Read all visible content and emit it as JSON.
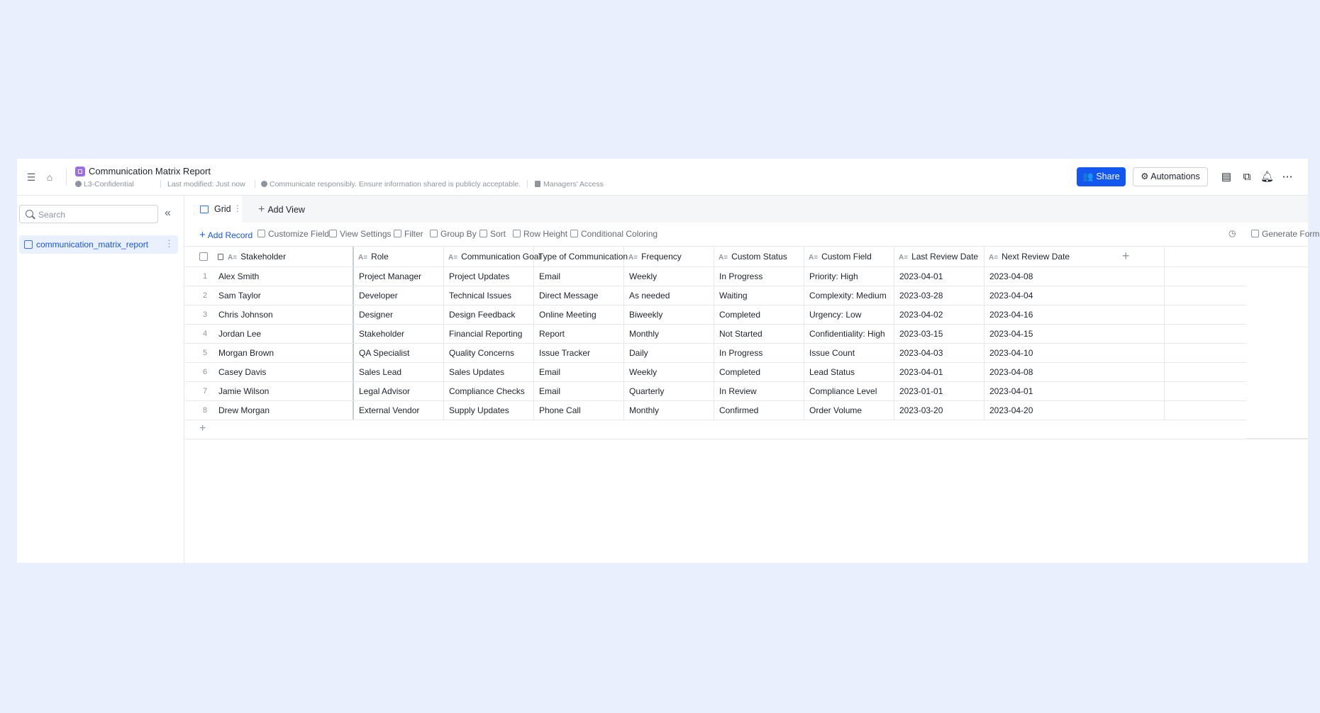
{
  "header": {
    "title": "Communication Matrix Report",
    "classification": "L3-Confidential",
    "last_modified": "Last modified: Just now",
    "notice": "Communicate responsibly. Ensure information shared is publicly acceptable.",
    "access": "Managers' Access",
    "share_label": "Share",
    "automations_label": "Automations"
  },
  "sidebar": {
    "search_placeholder": "Search",
    "items": [
      {
        "label": "communication_matrix_report"
      }
    ]
  },
  "views": {
    "active_tab": "Grid",
    "add_view_label": "Add View"
  },
  "toolbar": {
    "add_record": "Add Record",
    "customize_field": "Customize Field",
    "view_settings": "View Settings",
    "filter": "Filter",
    "group_by": "Group By",
    "sort": "Sort",
    "row_height": "Row Height",
    "conditional_coloring": "Conditional Coloring",
    "generate_form": "Generate Form"
  },
  "table": {
    "columns": [
      "Stakeholder",
      "Role",
      "Communication Goal",
      "Type of Communication",
      "Frequency",
      "Custom Status",
      "Custom Field",
      "Last Review Date",
      "Next Review Date"
    ],
    "rows": [
      [
        "Alex Smith",
        "Project Manager",
        "Project Updates",
        "Email",
        "Weekly",
        "In Progress",
        "Priority: High",
        "2023-04-01",
        "2023-04-08"
      ],
      [
        "Sam Taylor",
        "Developer",
        "Technical Issues",
        "Direct Message",
        "As needed",
        "Waiting",
        "Complexity: Medium",
        "2023-03-28",
        "2023-04-04"
      ],
      [
        "Chris Johnson",
        "Designer",
        "Design Feedback",
        "Online Meeting",
        "Biweekly",
        "Completed",
        "Urgency: Low",
        "2023-04-02",
        "2023-04-16"
      ],
      [
        "Jordan Lee",
        "Stakeholder",
        "Financial Reporting",
        "Report",
        "Monthly",
        "Not Started",
        "Confidentiality: High",
        "2023-03-15",
        "2023-04-15"
      ],
      [
        "Morgan Brown",
        "QA Specialist",
        "Quality Concerns",
        "Issue Tracker",
        "Daily",
        "In Progress",
        "Issue Count",
        "2023-04-03",
        "2023-04-10"
      ],
      [
        "Casey Davis",
        "Sales Lead",
        "Sales Updates",
        "Email",
        "Weekly",
        "Completed",
        "Lead Status",
        "2023-04-01",
        "2023-04-08"
      ],
      [
        "Jamie Wilson",
        "Legal Advisor",
        "Compliance Checks",
        "Email",
        "Quarterly",
        "In Review",
        "Compliance Level",
        "2023-01-01",
        "2023-04-01"
      ],
      [
        "Drew Morgan",
        "External Vendor",
        "Supply Updates",
        "Phone Call",
        "Monthly",
        "Confirmed",
        "Order Volume",
        "2023-03-20",
        "2023-04-20"
      ]
    ]
  }
}
